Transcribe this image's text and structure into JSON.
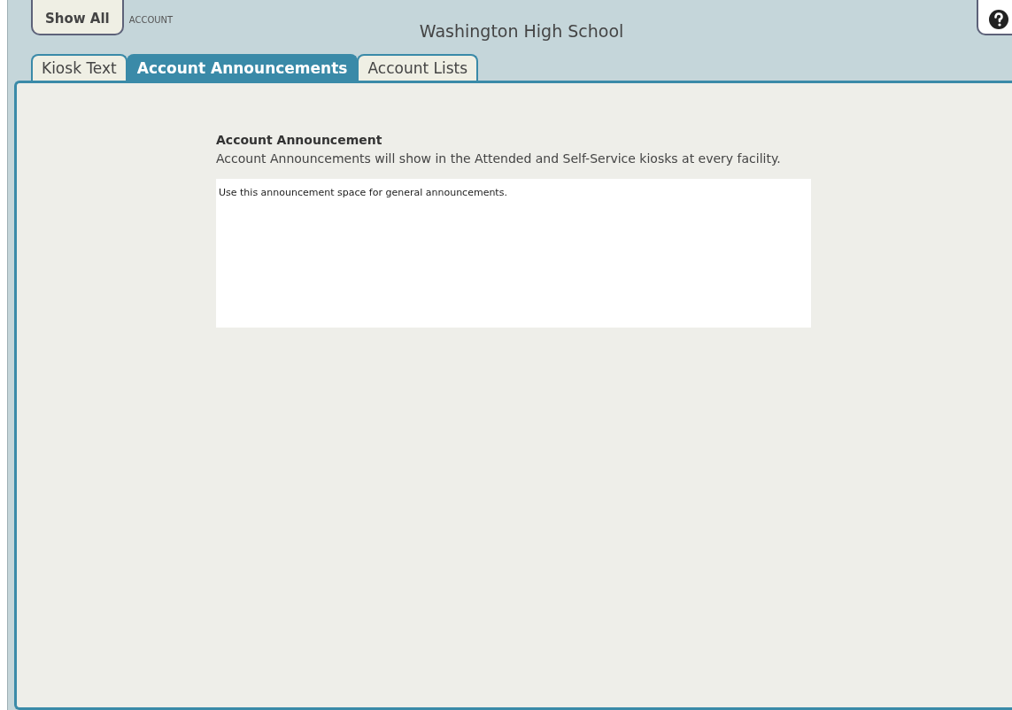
{
  "header": {
    "show_all_button": "Show All",
    "context_label": "ACCOUNT",
    "title": "Washington High School"
  },
  "tabs": [
    {
      "label": "Kiosk Text",
      "selected": false
    },
    {
      "label": "Account Announcements",
      "selected": true
    },
    {
      "label": "Account Lists",
      "selected": false
    }
  ],
  "announcement": {
    "heading": "Account Announcement",
    "description": "Account Announcements will show in the Attended and Self-Service kiosks at every facility.",
    "value": "Use this announcement space for general announcements."
  }
}
